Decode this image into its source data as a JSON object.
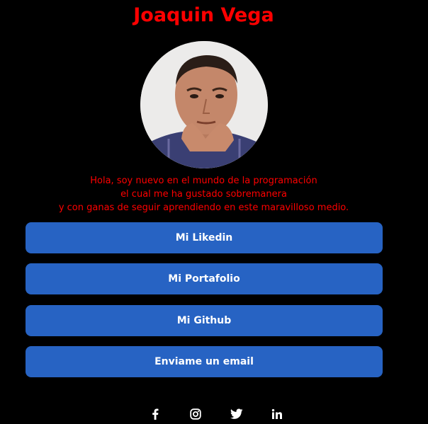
{
  "profile": {
    "name": "Joaquin Vega",
    "bio_lines": [
      "Hola, soy nuevo en el mundo de la programación",
      "el cual me ha gustado sobremanera",
      "y con ganas de seguir aprendiendo en este maravilloso medio."
    ]
  },
  "links": [
    {
      "label": "Mi Likedin"
    },
    {
      "label": "Mi Portafolio"
    },
    {
      "label": "Mi Github"
    },
    {
      "label": "Enviame un email"
    }
  ],
  "social": [
    {
      "icon": "facebook-icon"
    },
    {
      "icon": "instagram-icon"
    },
    {
      "icon": "twitter-icon"
    },
    {
      "icon": "linkedin-icon"
    }
  ],
  "colors": {
    "background": "#000000",
    "accent_text": "#ff0000",
    "button": "#2763c3",
    "button_text": "#ffffff"
  }
}
